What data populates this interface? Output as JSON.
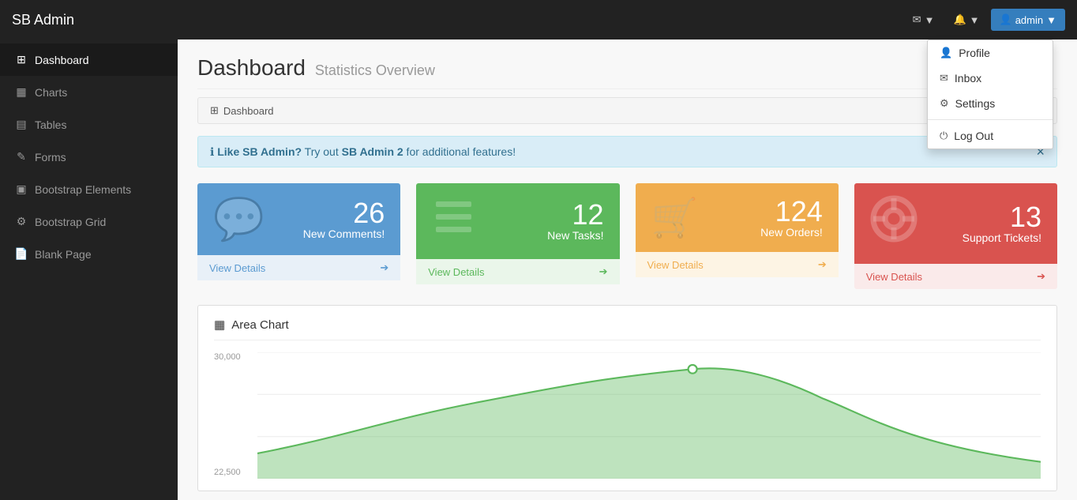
{
  "app": {
    "brand": "SB Admin"
  },
  "navbar": {
    "mail_label": "✉",
    "bell_label": "🔔",
    "admin_label": "admin",
    "dropdown_arrow": "▼"
  },
  "dropdown": {
    "items": [
      {
        "id": "profile",
        "icon": "👤",
        "label": "Profile"
      },
      {
        "id": "inbox",
        "icon": "✉",
        "label": "Inbox"
      },
      {
        "id": "settings",
        "icon": "⚙",
        "label": "Settings"
      }
    ],
    "logout_label": "Log Out",
    "logout_icon": "⏻"
  },
  "sidebar": {
    "items": [
      {
        "id": "dashboard",
        "icon": "⊞",
        "label": "Dashboard",
        "active": true
      },
      {
        "id": "charts",
        "icon": "▦",
        "label": "Charts"
      },
      {
        "id": "tables",
        "icon": "▤",
        "label": "Tables"
      },
      {
        "id": "forms",
        "icon": "✎",
        "label": "Forms"
      },
      {
        "id": "bootstrap-elements",
        "icon": "▣",
        "label": "Bootstrap Elements"
      },
      {
        "id": "bootstrap-grid",
        "icon": "⚙",
        "label": "Bootstrap Grid"
      },
      {
        "id": "blank-page",
        "icon": "📄",
        "label": "Blank Page"
      }
    ]
  },
  "page": {
    "title": "Dashboard",
    "subtitle": "Statistics Overview",
    "breadcrumb_icon": "⊞",
    "breadcrumb_label": "Dashboard"
  },
  "alert": {
    "icon": "ℹ",
    "text": "Like SB Admin?",
    "cta_prefix": " Try out ",
    "cta_link": "SB Admin 2",
    "cta_suffix": " for additional features!"
  },
  "cards": [
    {
      "id": "comments",
      "color": "blue",
      "icon": "💬",
      "number": "26",
      "label": "New Comments!",
      "link_label": "View Details",
      "arrow": "➔"
    },
    {
      "id": "tasks",
      "color": "green",
      "icon": "≡",
      "number": "12",
      "label": "New Tasks!",
      "link_label": "View Details",
      "arrow": "➔"
    },
    {
      "id": "orders",
      "color": "yellow",
      "icon": "🛒",
      "number": "124",
      "label": "New Orders!",
      "link_label": "View Details",
      "arrow": "➔"
    },
    {
      "id": "tickets",
      "color": "red",
      "icon": "🛟",
      "number": "13",
      "label": "Support Tickets!",
      "link_label": "View Details",
      "arrow": "➔"
    }
  ],
  "chart": {
    "title": "Area Chart",
    "icon": "▦",
    "y_labels": [
      "30,000",
      "22,500"
    ]
  }
}
